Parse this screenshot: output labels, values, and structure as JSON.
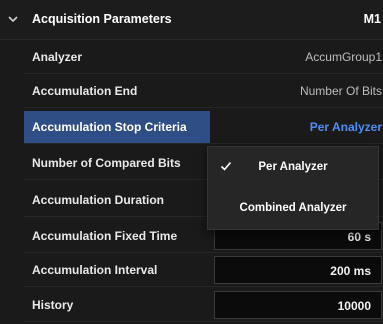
{
  "header": {
    "title": "Acquisition Parameters",
    "tag": "M1"
  },
  "rows": [
    {
      "label": "Analyzer",
      "value": "AccumGroup1",
      "kind": "dropdown"
    },
    {
      "label": "Accumulation End",
      "value": "Number Of Bits",
      "kind": "dropdown"
    },
    {
      "label": "Accumulation Stop Criteria",
      "value": "Per Analyzer",
      "kind": "dropdown",
      "expanded": true
    },
    {
      "label": "Number of Compared Bits",
      "value": "",
      "kind": "hidden"
    },
    {
      "label": "Accumulation Duration",
      "value": "",
      "kind": "hidden"
    },
    {
      "label": "Accumulation Fixed Time",
      "value": "60 s",
      "kind": "input"
    },
    {
      "label": "Accumulation Interval",
      "value": "200 ms",
      "kind": "input"
    },
    {
      "label": "History",
      "value": "10000",
      "kind": "input"
    }
  ],
  "dropdown_menu": {
    "options": [
      {
        "label": "Per Analyzer",
        "checked": true
      },
      {
        "label": "Combined Analyzer",
        "checked": false
      }
    ]
  },
  "icons": {
    "header_toggle": "chevron-down-icon",
    "dropdown_caret": "chevron-down-icon",
    "expanded_caret": "chevron-up-icon",
    "selected_option": "check-icon"
  },
  "colors": {
    "selection_bg": "#2f4e86",
    "accent_text": "#4f8ef7",
    "panel_bg": "#1a1a1a",
    "input_bg": "#0b0b0b"
  }
}
